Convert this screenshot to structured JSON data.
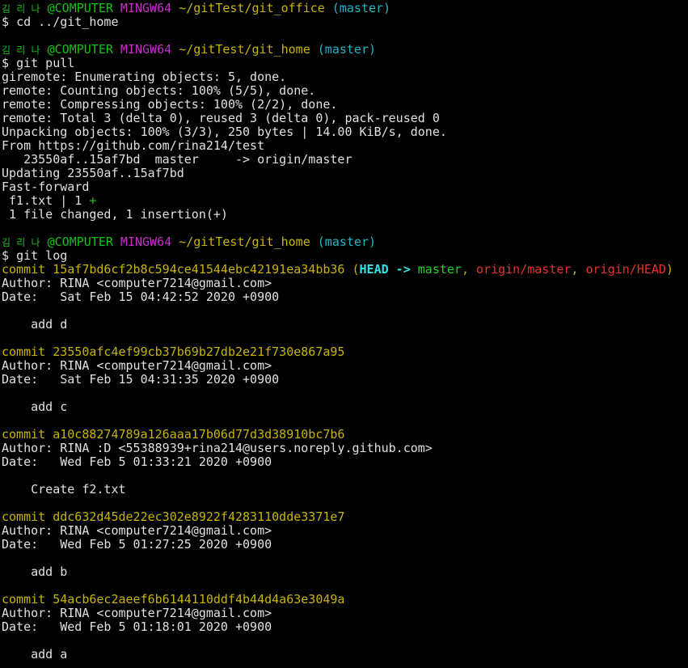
{
  "prompt": {
    "user": "김 리 나",
    "at_host": "@COMPUTER",
    "env": "MINGW64",
    "branch": "(master)",
    "path_office": "~/gitTest/git_office",
    "path_home": "~/gitTest/git_home",
    "symbol": "$"
  },
  "commands": {
    "cd": "cd ../git_home",
    "pull": "git pull",
    "log": "git log"
  },
  "pull_output": [
    "giremote: Enumerating objects: 5, done.",
    "remote: Counting objects: 100% (5/5), done.",
    "remote: Compressing objects: 100% (2/2), done.",
    "remote: Total 3 (delta 0), reused 3 (delta 0), pack-reused 0",
    "Unpacking objects: 100% (3/3), 250 bytes | 14.00 KiB/s, done.",
    "From https://github.com/rina214/test",
    "   23550af..15af7bd  master     -> origin/master",
    "Updating 23550af..15af7bd",
    "Fast-forward"
  ],
  "diffstat": {
    "file": " f1.txt | 1 ",
    "plus": "+",
    "summary": " 1 file changed, 1 insertion(+)"
  },
  "head_refs": {
    "open": "(",
    "head": "HEAD -> ",
    "master": "master",
    "sep": ", ",
    "origin_master": "origin/master",
    "origin_head": "origin/HEAD",
    "close": ")"
  },
  "commits": [
    {
      "hash_line": "commit 15af7bd6cf2b8c594ce41544ebc42191ea34bb36 ",
      "author": "Author: RINA <computer7214@gmail.com>",
      "date": "Date:   Sat Feb 15 04:42:52 2020 +0900",
      "message": "    add d"
    },
    {
      "hash_line": "commit 23550afc4ef99cb37b69b27db2e21f730e867a95",
      "author": "Author: RINA <computer7214@gmail.com>",
      "date": "Date:   Sat Feb 15 04:31:35 2020 +0900",
      "message": "    add c"
    },
    {
      "hash_line": "commit a10c88274789a126aaa17b06d77d3d38910bc7b6",
      "author": "Author: RINA :D <55388939+rina214@users.noreply.github.com>",
      "date": "Date:   Wed Feb 5 01:33:21 2020 +0900",
      "message": "    Create f2.txt"
    },
    {
      "hash_line": "commit ddc632d45de22ec302e8922f4283110dde3371e7",
      "author": "Author: RINA <computer7214@gmail.com>",
      "date": "Date:   Wed Feb 5 01:27:25 2020 +0900",
      "message": "    add b"
    },
    {
      "hash_line": "commit 54acb6ec2aeef6b6144110ddf4b44d4a63e3049a",
      "author": "Author: RINA <computer7214@gmail.com>",
      "date": "Date:   Wed Feb 5 01:18:01 2020 +0900",
      "message": "    add a"
    }
  ],
  "colors": {
    "background": "#000000",
    "text": "#e0e0e0",
    "prompt_user": "#13c313",
    "prompt_env": "#c72dc7",
    "prompt_path": "#c8b400",
    "prompt_branch": "#1fb5c8",
    "commit_hash": "#c8b400",
    "ref_head": "#34e2e2",
    "ref_master": "#23d323",
    "ref_origin": "#e63232"
  }
}
